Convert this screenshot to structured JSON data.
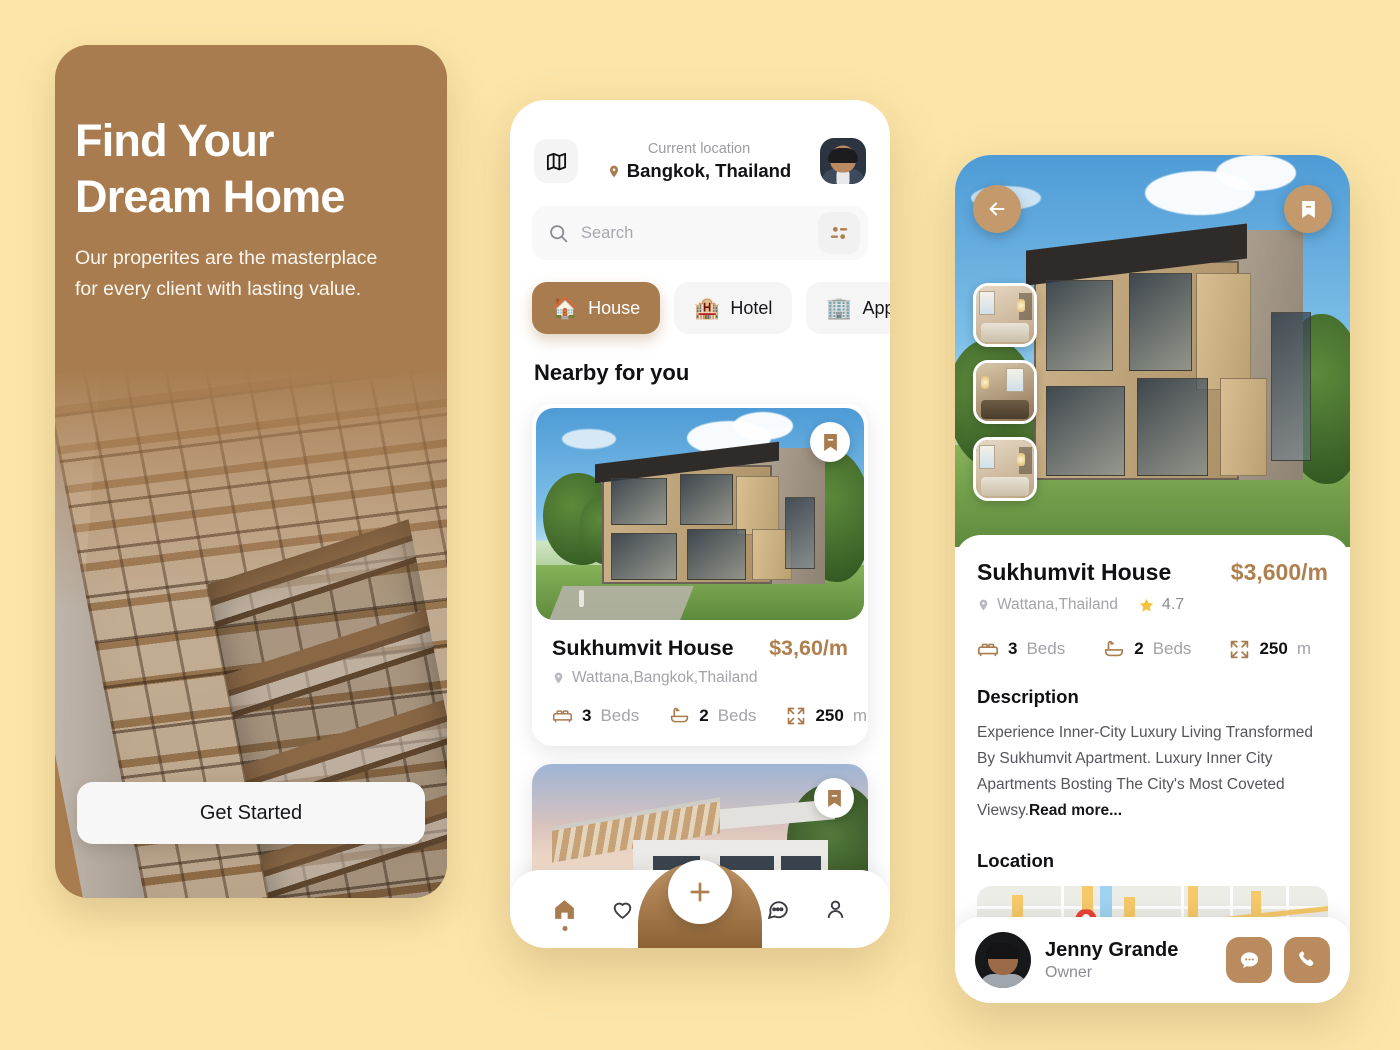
{
  "background_color": "#FCE5A8",
  "accent_brown": "#A87C4F",
  "price_color": "#B07F4E",
  "hero": {
    "headline_line1": "Find Your",
    "headline_line2": "Dream Home",
    "subcopy_line1": "Our properites are the masterplace",
    "subcopy_line2": "for every client with lasting value.",
    "cta_label": "Get Started"
  },
  "home_screen": {
    "map_icon": "map-icon",
    "location_label": "Current location",
    "location_value": "Bangkok, Thailand",
    "location_pin_icon": "location-pin-icon",
    "avatar": "user-avatar",
    "search": {
      "placeholder": "Search",
      "value": "",
      "search_icon": "search-icon",
      "filter_icon": "filter-icon"
    },
    "categories": [
      {
        "label": "House",
        "emoji": "🏠",
        "active": true
      },
      {
        "label": "Hotel",
        "emoji": "🏨",
        "active": false
      },
      {
        "label": "Appartment",
        "emoji": "🏢",
        "active": false
      }
    ],
    "section_title": "Nearby for you",
    "listing": {
      "title": "Sukhumvit House",
      "price": "$3,60/m",
      "location": "Wattana,Bangkok,Thailand",
      "specs": [
        {
          "icon": "bed-icon",
          "value": "3",
          "unit": "Beds"
        },
        {
          "icon": "bath-icon",
          "value": "2",
          "unit": "Beds"
        },
        {
          "icon": "area-expand-icon",
          "value": "250",
          "unit": "m"
        }
      ],
      "bookmark_icon": "bookmark-icon"
    },
    "listing2": {
      "bookmark_icon": "bookmark-icon"
    },
    "bottom_nav": [
      {
        "name": "home",
        "icon": "home-icon",
        "active": true
      },
      {
        "name": "favorites",
        "icon": "heart-icon",
        "active": false
      },
      {
        "name": "add",
        "icon": "plus-icon",
        "active": false
      },
      {
        "name": "messages",
        "icon": "chat-bubble-icon",
        "active": false
      },
      {
        "name": "profile",
        "icon": "person-icon",
        "active": false
      }
    ]
  },
  "detail_screen": {
    "back_icon": "arrow-left-icon",
    "bookmark_icon": "bookmark-icon",
    "thumbnails": [
      "interior-thumb-1",
      "interior-thumb-2",
      "interior-thumb-3"
    ],
    "title": "Sukhumvit House",
    "price": "$3,600/m",
    "location": "Wattana,Thailand",
    "rating": "4.7",
    "star_icon": "star-icon",
    "specs": [
      {
        "icon": "bed-icon",
        "value": "3",
        "unit": "Beds"
      },
      {
        "icon": "bath-icon",
        "value": "2",
        "unit": "Beds"
      },
      {
        "icon": "area-expand-icon",
        "value": "250",
        "unit": "m"
      }
    ],
    "description_heading": "Description",
    "description_body": "Experience Inner-City Luxury Living Transformed By Sukhumvit Apartment. Luxury Inner City Apartments Bosting The City's Most Coveted Viewsy.",
    "read_more_label": "Read more...",
    "location_heading": "Location",
    "map_pin_icon": "map-pin-icon",
    "agent": {
      "name": "Jenny Grande",
      "role": "Owner",
      "message_icon": "chat-bubble-icon",
      "call_icon": "phone-icon"
    }
  }
}
